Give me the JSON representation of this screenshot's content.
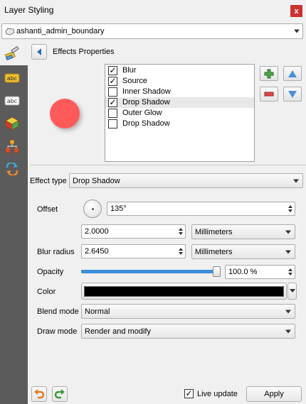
{
  "window": {
    "title": "Layer Styling",
    "close_symbol": "x"
  },
  "layer_combo": {
    "value": "ashanti_admin_boundary"
  },
  "header": {
    "title": "Effects Properties"
  },
  "effects_list": [
    {
      "label": "Blur",
      "checked": true,
      "selected": false
    },
    {
      "label": "Source",
      "checked": true,
      "selected": false
    },
    {
      "label": "Inner Shadow",
      "checked": false,
      "selected": false
    },
    {
      "label": "Drop Shadow",
      "checked": true,
      "selected": true
    },
    {
      "label": "Outer Glow",
      "checked": false,
      "selected": false
    },
    {
      "label": "Drop Shadow",
      "checked": false,
      "selected": false
    }
  ],
  "check_mark": "✓",
  "effect_type": {
    "label": "Effect type",
    "value": "Drop Shadow"
  },
  "offset": {
    "label": "Offset",
    "angle": "135°",
    "distance": "2.0000",
    "unit": "Millimeters"
  },
  "blur_radius": {
    "label": "Blur radius",
    "value": "2.6450",
    "unit": "Millimeters"
  },
  "opacity": {
    "label": "Opacity",
    "value": "100.0 %",
    "fraction": 1.0
  },
  "color": {
    "label": "Color",
    "value": "#000000"
  },
  "blend_mode": {
    "label": "Blend mode",
    "value": "Normal"
  },
  "draw_mode": {
    "label": "Draw mode",
    "value": "Render and modify"
  },
  "footer": {
    "live_update_label": "Live update",
    "live_update_checked": true,
    "apply_label": "Apply"
  },
  "colors": {
    "sidebar": "#5b5b5b",
    "preview_dot": "#ff5a5a",
    "accent": "#3c8fd8"
  },
  "icons": {
    "sidebar": [
      "paintbrush-icon",
      "label-abc-yellow-icon",
      "label-abc-icon",
      "3d-cube-icon",
      "diagram-icon",
      "history-icon"
    ],
    "undo": "undo-icon",
    "redo": "redo-icon"
  }
}
